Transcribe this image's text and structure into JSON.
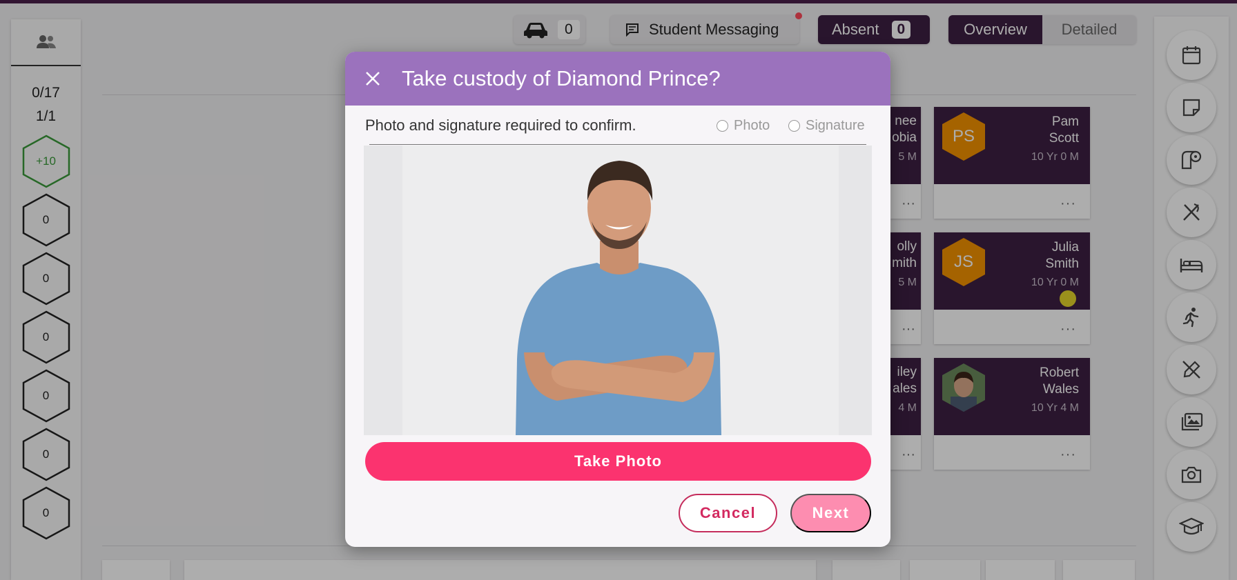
{
  "sidebar": {
    "present_count": "0/17",
    "group_count": "1/1",
    "hexes": [
      "+10",
      "0",
      "0",
      "0",
      "0",
      "0",
      "0"
    ]
  },
  "topbar": {
    "car_count": "0",
    "messaging_label": "Student Messaging",
    "absent_label": "Absent",
    "absent_count": "0",
    "view_overview": "Overview",
    "view_detailed": "Detailed"
  },
  "cards": [
    {
      "name_line1": "Pam",
      "name_line2": "Scott",
      "initials": "PS",
      "age": "10 Yr 0 M",
      "more": "···"
    },
    {
      "name_line1": "Julia",
      "name_line2": "Smith",
      "initials": "JS",
      "age": "10 Yr 0 M",
      "more": "···"
    },
    {
      "name_line1": "Robert",
      "name_line2": "Wales",
      "initials": "",
      "age": "10 Yr 4 M",
      "more": "···"
    }
  ],
  "partial_cards": [
    {
      "line1": "nee",
      "line2": "obia",
      "age": "5 M",
      "more": "···"
    },
    {
      "line1": "olly",
      "line2": "mith",
      "age": "5 M",
      "more": "···"
    },
    {
      "line1": "iley",
      "line2": "ales",
      "age": "4 M",
      "more": "···"
    }
  ],
  "modal": {
    "title": "Take custody of Diamond Prince?",
    "subtitle": "Photo and signature required to confirm.",
    "radio_photo": "Photo",
    "radio_signature": "Signature",
    "take_photo_label": "Take Photo",
    "cancel_label": "Cancel",
    "next_label": "Next"
  },
  "colors": {
    "header_purple": "#9b72bd",
    "card_dark": "#3d2043",
    "accent_pink": "#fb336f",
    "next_disabled_pink": "#fd8db0",
    "avatar_orange": "#f39200"
  },
  "icons": {
    "rail": [
      "calendar-icon",
      "note-icon",
      "toilet-paper-icon",
      "meal-icon",
      "bed-icon",
      "activity-icon",
      "no-pen-icon",
      "gallery-icon",
      "camera-icon",
      "graduation-cap-icon"
    ]
  }
}
